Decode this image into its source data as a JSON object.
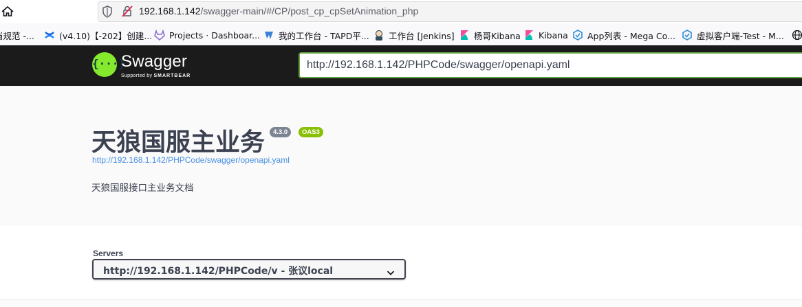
{
  "browser": {
    "url_host": "192.168.1.142",
    "url_path": "/swagger-main/#/CP/post_cp_cpSetAnimation_php",
    "bookmarks": [
      {
        "label": "当规范 -...",
        "icon": "document-icon"
      },
      {
        "label": "(v4.10)【-202】创建...",
        "icon": "confluence-icon"
      },
      {
        "label": "Projects · Dashboar...",
        "icon": "gitlab-icon"
      },
      {
        "label": "我的工作台 - TAPD平...",
        "icon": "tapd-icon"
      },
      {
        "label": "工作台 [Jenkins]",
        "icon": "jenkins-icon"
      },
      {
        "label": "杨哥Kibana",
        "icon": "kibana-icon"
      },
      {
        "label": "Kibana",
        "icon": "kibana-icon"
      },
      {
        "label": "App列表 - Mega Co...",
        "icon": "mega-icon"
      },
      {
        "label": "虚拟客户端-Test - M...",
        "icon": "mega-icon"
      }
    ]
  },
  "topbar": {
    "brand": "Swagger",
    "sub_prefix": "Supported by",
    "sub_brand": "SMARTBEAR",
    "spec_url": "http://192.168.1.142/PHPCode/swagger/openapi.yaml"
  },
  "info": {
    "title": "天狼国服主业务",
    "version": "4.3.0",
    "oas": "OAS3",
    "spec_link": "http://192.168.1.142/PHPCode/swagger/openapi.yaml",
    "description": "天狼国服接口主业务文档"
  },
  "servers": {
    "label": "Servers",
    "selected": "http://192.168.1.142/PHPCode/v - 张议local"
  },
  "colors": {
    "topbar_bg": "#1b1b1b",
    "swagger_green": "#85ea2d",
    "input_border": "#62a03f",
    "version_badge": "#7d8492",
    "oas_badge": "#89bf04",
    "link": "#4990e2"
  }
}
